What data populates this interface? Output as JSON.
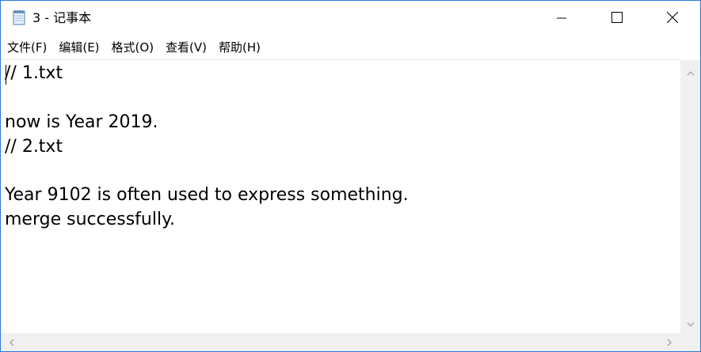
{
  "window": {
    "title": "3 - 记事本",
    "accent_color": "#2b79d8"
  },
  "icons": {
    "app": "notepad-icon",
    "minimize": "minimize-icon",
    "maximize": "maximize-icon",
    "close": "close-icon",
    "scroll_up": "chevron-up-icon",
    "scroll_down": "chevron-down-icon",
    "scroll_left": "chevron-left-icon",
    "scroll_right": "chevron-right-icon"
  },
  "menu": {
    "items": [
      {
        "label": "文件(F)"
      },
      {
        "label": "编辑(E)"
      },
      {
        "label": "格式(O)"
      },
      {
        "label": "查看(V)"
      },
      {
        "label": "帮助(H)"
      }
    ]
  },
  "document": {
    "lines": [
      "// 1.txt",
      "",
      "now is Year 2019.",
      "// 2.txt",
      "",
      "Year 9102 is often used to express something.",
      "merge successfully."
    ]
  }
}
